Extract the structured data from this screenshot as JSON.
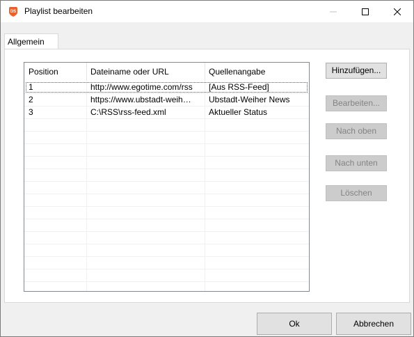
{
  "window": {
    "title": "Playlist bearbeiten",
    "app_icon": "ds-app-icon",
    "controls": [
      "minimize-icon",
      "maximize-icon",
      "close-icon"
    ]
  },
  "tabs": [
    {
      "label": "Allgemein",
      "selected": true
    }
  ],
  "playlist": {
    "columns": [
      "Position",
      "Dateiname oder URL",
      "Quellenangabe"
    ],
    "rows": [
      {
        "position": "1",
        "file": "http://www.egotime.com/rss",
        "source": "[Aus RSS-Feed]"
      },
      {
        "position": "2",
        "file": "https://www.ubstadt-weih…",
        "source": "Ubstadt-Weiher News"
      },
      {
        "position": "3",
        "file": "C:\\RSS\\rss-feed.xml",
        "source": "Aktueller Status"
      }
    ]
  },
  "actions": {
    "add": "Hinzufügen...",
    "edit": "Bearbeiten...",
    "move_up": "Nach oben",
    "move_down": "Nach unten",
    "delete": "Löschen"
  },
  "footer": {
    "ok": "Ok",
    "cancel": "Abbrechen"
  },
  "colors": {
    "window_bg": "#f0f0f0",
    "button_bg": "#e1e1e1",
    "disabled_button_bg": "#cccccc",
    "app_icon_orange": "#e8622c"
  }
}
